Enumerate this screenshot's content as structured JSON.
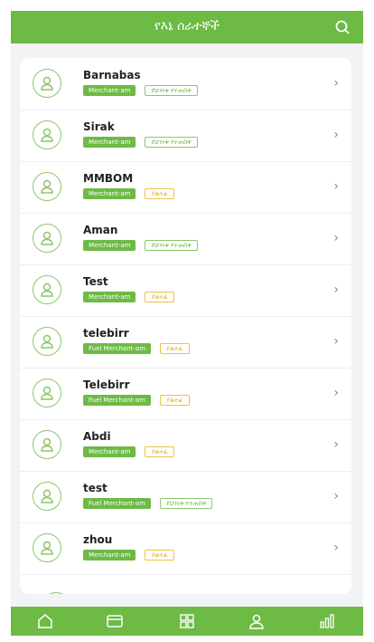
{
  "header": {
    "title": "የእኔ ሰራተኞች",
    "search_icon": "search-icon"
  },
  "merchants": [
    {
      "name": "Barnabas",
      "type": "Merchant-am",
      "status": "ደህንነቱ የተጠበቀ",
      "status_color": "green"
    },
    {
      "name": "Sirak",
      "type": "Merchant-am",
      "status": "ደህንነቱ የተጠበቀ",
      "status_color": "green"
    },
    {
      "name": "MMBOM",
      "type": "Merchant-am",
      "status": "ያልተፈ",
      "status_color": "yellow"
    },
    {
      "name": "Aman",
      "type": "Merchant-am",
      "status": "ደህንነቱ የተጠበቀ",
      "status_color": "green"
    },
    {
      "name": "Test",
      "type": "Merchant-am",
      "status": "ያልተፈ",
      "status_color": "yellow"
    },
    {
      "name": "telebirr",
      "type": "Fuel Merchant-am",
      "status": "ያልተፈ",
      "status_color": "yellow"
    },
    {
      "name": "Telebirr",
      "type": "Fuel Merchant-am",
      "status": "ያልተፈ",
      "status_color": "yellow"
    },
    {
      "name": "Abdi",
      "type": "Merchant-am",
      "status": "ያልተፈ",
      "status_color": "yellow"
    },
    {
      "name": "test",
      "type": "Fuel Merchant-am",
      "status": "ደህንነቱ የተጠበቀ",
      "status_color": "green"
    },
    {
      "name": "zhou",
      "type": "Merchant-am",
      "status": "ያልተፈ",
      "status_color": "yellow"
    }
  ],
  "nav": [
    "home-icon",
    "card-icon",
    "apps-grid-icon",
    "user-icon",
    "chart-icon"
  ],
  "colors": {
    "accent": "#6dba45",
    "warning": "#f0c040"
  }
}
